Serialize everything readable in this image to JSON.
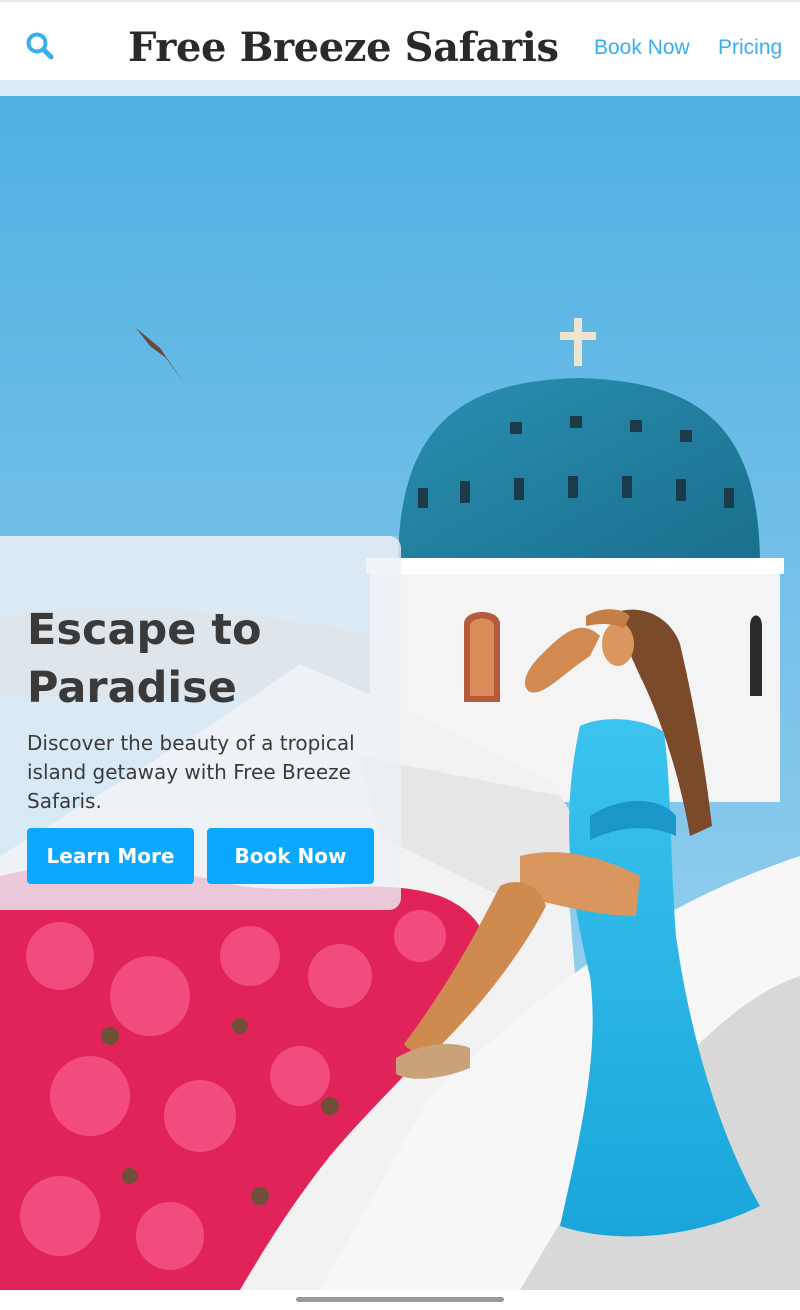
{
  "header": {
    "site_title": "Free Breeze Safaris",
    "search_icon": "search-icon",
    "nav": [
      {
        "label": "Book Now"
      },
      {
        "label": "Pricing"
      }
    ]
  },
  "hero": {
    "title": "Escape to Paradise",
    "description": "Discover the beauty of a tropical island getaway with Free Breeze Safaris.",
    "buttons": [
      {
        "label": "Learn More"
      },
      {
        "label": "Book Now"
      }
    ]
  },
  "colors": {
    "accent": "#0aa9ff",
    "nav_link": "#37aef0",
    "title_text": "#2a2a2a"
  }
}
